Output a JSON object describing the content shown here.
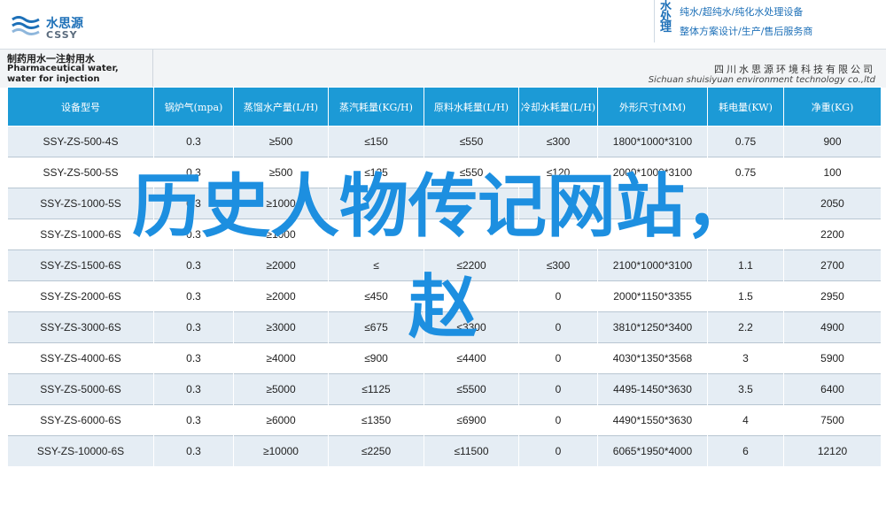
{
  "header": {
    "logo_cn": "水思源",
    "logo_en": "CSSY",
    "brand_vert": "水处理",
    "brand_line1": "纯水/超纯水/纯化水处理设备",
    "brand_line2": "整体方案设计/生产/售后服务商"
  },
  "titlebar": {
    "title_cn": "制药用水一注射用水",
    "title_en": "Pharmaceutical water, water for injection",
    "company_cn": "四川水思源环境科技有限公司",
    "company_en": "Sichuan shuisiyuan environment technology co.,ltd"
  },
  "table": {
    "headers": [
      "设备型号",
      "锅炉气(mpa)",
      "蒸馏水产量(L/H)",
      "蒸汽耗量(KG/H)",
      "原料水耗量(L/H)",
      "冷却水耗量(L/H)",
      "外形尺寸(MM)",
      "耗电量(KW)",
      "净重(KG)"
    ],
    "rows": [
      [
        "SSY-ZS-500-4S",
        "0.3",
        "≥500",
        "≤150",
        "≤550",
        "≤300",
        "1800*1000*3100",
        "0.75",
        "900"
      ],
      [
        "SSY-ZS-500-5S",
        "0.3",
        "≥500",
        "≤125",
        "≤550",
        "≤120",
        "2000*1000*3100",
        "0.75",
        "100"
      ],
      [
        "SSY-ZS-1000-5S",
        "0.3",
        "≥1000",
        "",
        "",
        "",
        "",
        "",
        "2050"
      ],
      [
        "SSY-ZS-1000-6S",
        "0.3",
        "≥1000",
        "",
        "",
        "",
        "",
        "",
        "2200"
      ],
      [
        "SSY-ZS-1500-6S",
        "0.3",
        "≥2000",
        "≤",
        "≤2200",
        "≤300",
        "2100*1000*3100",
        "1.1",
        "2700"
      ],
      [
        "SSY-ZS-2000-6S",
        "0.3",
        "≥2000",
        "≤450",
        "",
        "0",
        "2000*1150*3355",
        "1.5",
        "2950"
      ],
      [
        "SSY-ZS-3000-6S",
        "0.3",
        "≥3000",
        "≤675",
        "≤3300",
        "0",
        "3810*1250*3400",
        "2.2",
        "4900"
      ],
      [
        "SSY-ZS-4000-6S",
        "0.3",
        "≥4000",
        "≤900",
        "≤4400",
        "0",
        "4030*1350*3568",
        "3",
        "5900"
      ],
      [
        "SSY-ZS-5000-6S",
        "0.3",
        "≥5000",
        "≤1125",
        "≤5500",
        "0",
        "4495-1450*3630",
        "3.5",
        "6400"
      ],
      [
        "SSY-ZS-6000-6S",
        "0.3",
        "≥6000",
        "≤1350",
        "≤6900",
        "0",
        "4490*1550*3630",
        "4",
        "7500"
      ],
      [
        "SSY-ZS-10000-6S",
        "0.3",
        "≥10000",
        "≤2250",
        "≤11500",
        "0",
        "6065*1950*4000",
        "6",
        "12120"
      ]
    ]
  },
  "overlay": {
    "line1": "历史人物传记网站，",
    "line2": "赵"
  },
  "colors": {
    "header_blue": "#1c9ad6",
    "overlay_blue": "#1d8fe0",
    "row_shade": "#e5edf4"
  }
}
